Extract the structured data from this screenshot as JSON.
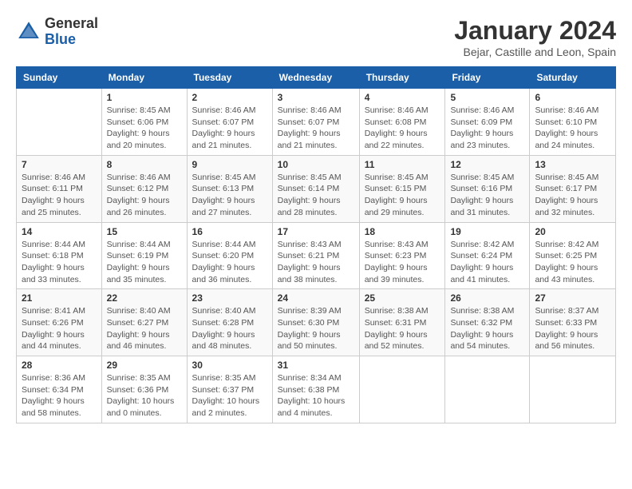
{
  "logo": {
    "general": "General",
    "blue": "Blue"
  },
  "title": "January 2024",
  "subtitle": "Bejar, Castille and Leon, Spain",
  "days_header": [
    "Sunday",
    "Monday",
    "Tuesday",
    "Wednesday",
    "Thursday",
    "Friday",
    "Saturday"
  ],
  "weeks": [
    [
      {
        "day": "",
        "sunrise": "",
        "sunset": "",
        "daylight": ""
      },
      {
        "day": "1",
        "sunrise": "Sunrise: 8:45 AM",
        "sunset": "Sunset: 6:06 PM",
        "daylight": "Daylight: 9 hours and 20 minutes."
      },
      {
        "day": "2",
        "sunrise": "Sunrise: 8:46 AM",
        "sunset": "Sunset: 6:07 PM",
        "daylight": "Daylight: 9 hours and 21 minutes."
      },
      {
        "day": "3",
        "sunrise": "Sunrise: 8:46 AM",
        "sunset": "Sunset: 6:07 PM",
        "daylight": "Daylight: 9 hours and 21 minutes."
      },
      {
        "day": "4",
        "sunrise": "Sunrise: 8:46 AM",
        "sunset": "Sunset: 6:08 PM",
        "daylight": "Daylight: 9 hours and 22 minutes."
      },
      {
        "day": "5",
        "sunrise": "Sunrise: 8:46 AM",
        "sunset": "Sunset: 6:09 PM",
        "daylight": "Daylight: 9 hours and 23 minutes."
      },
      {
        "day": "6",
        "sunrise": "Sunrise: 8:46 AM",
        "sunset": "Sunset: 6:10 PM",
        "daylight": "Daylight: 9 hours and 24 minutes."
      }
    ],
    [
      {
        "day": "7",
        "sunrise": "Sunrise: 8:46 AM",
        "sunset": "Sunset: 6:11 PM",
        "daylight": "Daylight: 9 hours and 25 minutes."
      },
      {
        "day": "8",
        "sunrise": "Sunrise: 8:46 AM",
        "sunset": "Sunset: 6:12 PM",
        "daylight": "Daylight: 9 hours and 26 minutes."
      },
      {
        "day": "9",
        "sunrise": "Sunrise: 8:45 AM",
        "sunset": "Sunset: 6:13 PM",
        "daylight": "Daylight: 9 hours and 27 minutes."
      },
      {
        "day": "10",
        "sunrise": "Sunrise: 8:45 AM",
        "sunset": "Sunset: 6:14 PM",
        "daylight": "Daylight: 9 hours and 28 minutes."
      },
      {
        "day": "11",
        "sunrise": "Sunrise: 8:45 AM",
        "sunset": "Sunset: 6:15 PM",
        "daylight": "Daylight: 9 hours and 29 minutes."
      },
      {
        "day": "12",
        "sunrise": "Sunrise: 8:45 AM",
        "sunset": "Sunset: 6:16 PM",
        "daylight": "Daylight: 9 hours and 31 minutes."
      },
      {
        "day": "13",
        "sunrise": "Sunrise: 8:45 AM",
        "sunset": "Sunset: 6:17 PM",
        "daylight": "Daylight: 9 hours and 32 minutes."
      }
    ],
    [
      {
        "day": "14",
        "sunrise": "Sunrise: 8:44 AM",
        "sunset": "Sunset: 6:18 PM",
        "daylight": "Daylight: 9 hours and 33 minutes."
      },
      {
        "day": "15",
        "sunrise": "Sunrise: 8:44 AM",
        "sunset": "Sunset: 6:19 PM",
        "daylight": "Daylight: 9 hours and 35 minutes."
      },
      {
        "day": "16",
        "sunrise": "Sunrise: 8:44 AM",
        "sunset": "Sunset: 6:20 PM",
        "daylight": "Daylight: 9 hours and 36 minutes."
      },
      {
        "day": "17",
        "sunrise": "Sunrise: 8:43 AM",
        "sunset": "Sunset: 6:21 PM",
        "daylight": "Daylight: 9 hours and 38 minutes."
      },
      {
        "day": "18",
        "sunrise": "Sunrise: 8:43 AM",
        "sunset": "Sunset: 6:23 PM",
        "daylight": "Daylight: 9 hours and 39 minutes."
      },
      {
        "day": "19",
        "sunrise": "Sunrise: 8:42 AM",
        "sunset": "Sunset: 6:24 PM",
        "daylight": "Daylight: 9 hours and 41 minutes."
      },
      {
        "day": "20",
        "sunrise": "Sunrise: 8:42 AM",
        "sunset": "Sunset: 6:25 PM",
        "daylight": "Daylight: 9 hours and 43 minutes."
      }
    ],
    [
      {
        "day": "21",
        "sunrise": "Sunrise: 8:41 AM",
        "sunset": "Sunset: 6:26 PM",
        "daylight": "Daylight: 9 hours and 44 minutes."
      },
      {
        "day": "22",
        "sunrise": "Sunrise: 8:40 AM",
        "sunset": "Sunset: 6:27 PM",
        "daylight": "Daylight: 9 hours and 46 minutes."
      },
      {
        "day": "23",
        "sunrise": "Sunrise: 8:40 AM",
        "sunset": "Sunset: 6:28 PM",
        "daylight": "Daylight: 9 hours and 48 minutes."
      },
      {
        "day": "24",
        "sunrise": "Sunrise: 8:39 AM",
        "sunset": "Sunset: 6:30 PM",
        "daylight": "Daylight: 9 hours and 50 minutes."
      },
      {
        "day": "25",
        "sunrise": "Sunrise: 8:38 AM",
        "sunset": "Sunset: 6:31 PM",
        "daylight": "Daylight: 9 hours and 52 minutes."
      },
      {
        "day": "26",
        "sunrise": "Sunrise: 8:38 AM",
        "sunset": "Sunset: 6:32 PM",
        "daylight": "Daylight: 9 hours and 54 minutes."
      },
      {
        "day": "27",
        "sunrise": "Sunrise: 8:37 AM",
        "sunset": "Sunset: 6:33 PM",
        "daylight": "Daylight: 9 hours and 56 minutes."
      }
    ],
    [
      {
        "day": "28",
        "sunrise": "Sunrise: 8:36 AM",
        "sunset": "Sunset: 6:34 PM",
        "daylight": "Daylight: 9 hours and 58 minutes."
      },
      {
        "day": "29",
        "sunrise": "Sunrise: 8:35 AM",
        "sunset": "Sunset: 6:36 PM",
        "daylight": "Daylight: 10 hours and 0 minutes."
      },
      {
        "day": "30",
        "sunrise": "Sunrise: 8:35 AM",
        "sunset": "Sunset: 6:37 PM",
        "daylight": "Daylight: 10 hours and 2 minutes."
      },
      {
        "day": "31",
        "sunrise": "Sunrise: 8:34 AM",
        "sunset": "Sunset: 6:38 PM",
        "daylight": "Daylight: 10 hours and 4 minutes."
      },
      {
        "day": "",
        "sunrise": "",
        "sunset": "",
        "daylight": ""
      },
      {
        "day": "",
        "sunrise": "",
        "sunset": "",
        "daylight": ""
      },
      {
        "day": "",
        "sunrise": "",
        "sunset": "",
        "daylight": ""
      }
    ]
  ]
}
